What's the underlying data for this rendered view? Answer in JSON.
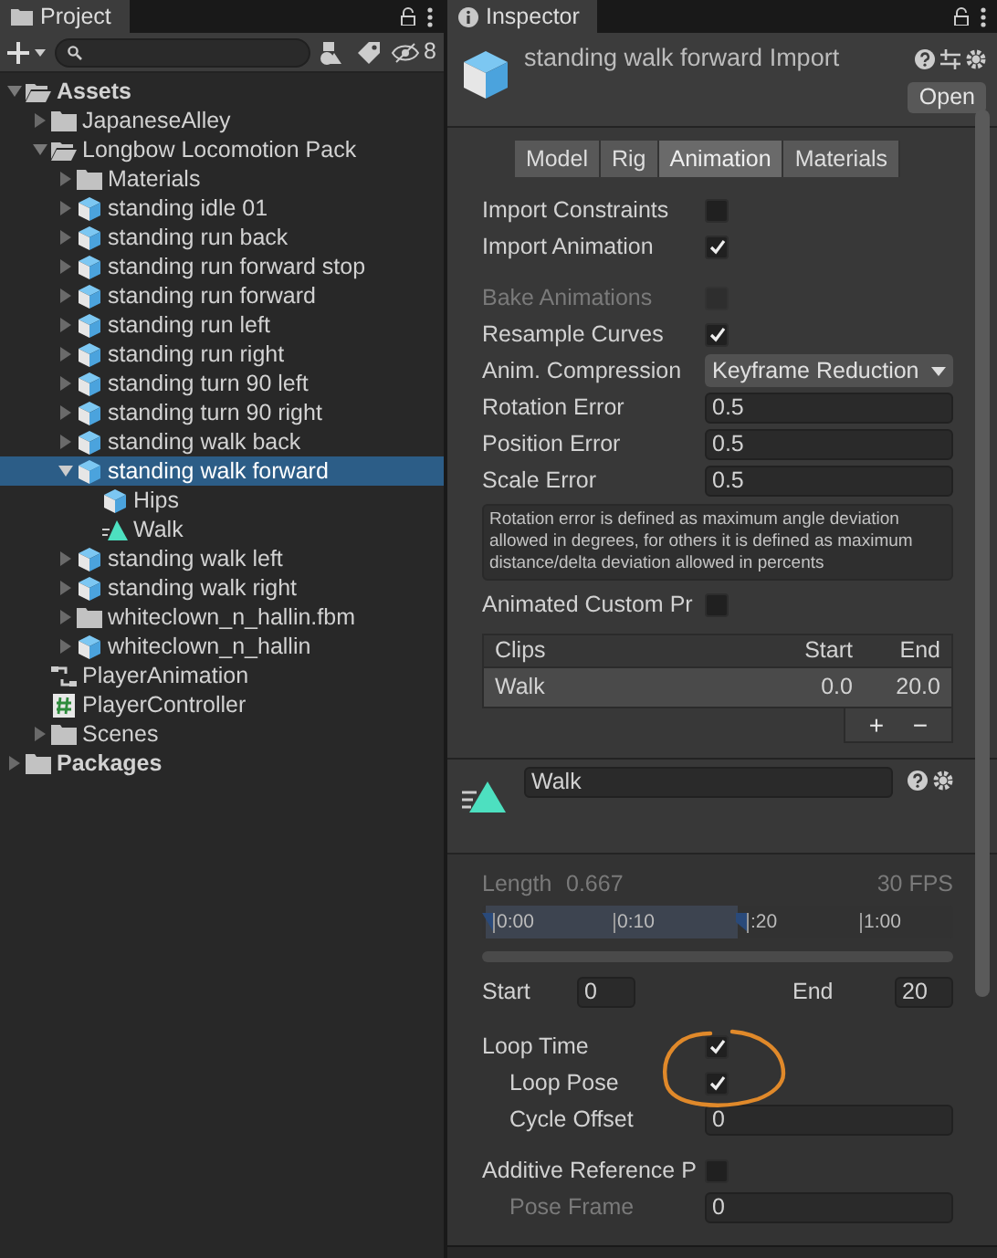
{
  "project": {
    "title": "Project",
    "hidden_count": "8",
    "tree": [
      {
        "label": "Assets",
        "kind": "folder",
        "expanded": true,
        "selected": false,
        "children": [
          {
            "label": "JapaneseAlley",
            "kind": "folder",
            "expanded": false,
            "selected": false
          },
          {
            "label": "Longbow Locomotion Pack",
            "kind": "folder",
            "expanded": true,
            "selected": false,
            "children": [
              {
                "label": "Materials",
                "kind": "folder",
                "expanded": false,
                "selected": false
              },
              {
                "label": "standing idle 01",
                "kind": "model",
                "expanded": false,
                "selected": false
              },
              {
                "label": "standing run back",
                "kind": "model",
                "expanded": false,
                "selected": false
              },
              {
                "label": "standing run forward stop",
                "kind": "model",
                "expanded": false,
                "selected": false
              },
              {
                "label": "standing run forward",
                "kind": "model",
                "expanded": false,
                "selected": false
              },
              {
                "label": "standing run left",
                "kind": "model",
                "expanded": false,
                "selected": false
              },
              {
                "label": "standing run right",
                "kind": "model",
                "expanded": false,
                "selected": false
              },
              {
                "label": "standing turn 90 left",
                "kind": "model",
                "expanded": false,
                "selected": false
              },
              {
                "label": "standing turn 90 right",
                "kind": "model",
                "expanded": false,
                "selected": false
              },
              {
                "label": "standing walk back",
                "kind": "model",
                "expanded": false,
                "selected": false
              },
              {
                "label": "standing walk forward",
                "kind": "model",
                "expanded": true,
                "selected": true,
                "children": [
                  {
                    "label": "Hips",
                    "kind": "model",
                    "selected": false
                  },
                  {
                    "label": "Walk",
                    "kind": "clip",
                    "selected": false
                  }
                ]
              },
              {
                "label": "standing walk left",
                "kind": "model",
                "expanded": false,
                "selected": false
              },
              {
                "label": "standing walk right",
                "kind": "model",
                "expanded": false,
                "selected": false
              },
              {
                "label": "whiteclown_n_hallin.fbm",
                "kind": "folder",
                "expanded": false,
                "selected": false
              },
              {
                "label": "whiteclown_n_hallin",
                "kind": "model",
                "expanded": false,
                "selected": false
              }
            ]
          },
          {
            "label": "PlayerAnimation",
            "kind": "controller",
            "selected": false
          },
          {
            "label": "PlayerController",
            "kind": "script",
            "selected": false
          },
          {
            "label": "Scenes",
            "kind": "folder",
            "expanded": false,
            "selected": false
          }
        ]
      },
      {
        "label": "Packages",
        "kind": "folder",
        "expanded": false,
        "selected": false
      }
    ]
  },
  "inspector": {
    "title": "Inspector",
    "asset_title": "standing walk forward Import",
    "open_button": "Open",
    "tabs": [
      {
        "label": "Model",
        "selected": false
      },
      {
        "label": "Rig",
        "selected": false
      },
      {
        "label": "Animation",
        "selected": true
      },
      {
        "label": "Materials",
        "selected": false
      }
    ],
    "fields": [
      {
        "kind": "checkbox",
        "label": "Import Constraints",
        "checked": false,
        "disabled": false
      },
      {
        "kind": "checkbox",
        "label": "Import Animation",
        "checked": true,
        "disabled": false
      },
      {
        "kind": "gap"
      },
      {
        "kind": "checkbox",
        "label": "Bake Animations",
        "checked": false,
        "disabled": true
      },
      {
        "kind": "checkbox",
        "label": "Resample Curves",
        "checked": true,
        "disabled": false
      },
      {
        "kind": "dropdown",
        "label": "Anim. Compression",
        "value": "Keyframe Reduction"
      },
      {
        "kind": "text",
        "label": "Rotation Error",
        "value": "0.5"
      },
      {
        "kind": "text",
        "label": "Position Error",
        "value": "0.5"
      },
      {
        "kind": "text",
        "label": "Scale Error",
        "value": "0.5"
      },
      {
        "kind": "help",
        "text": "Rotation error is defined as maximum angle deviation allowed in degrees, for others it is defined as maximum distance/delta deviation allowed in percents"
      },
      {
        "kind": "checkbox",
        "label": "Animated Custom Pr",
        "checked": false,
        "disabled": false
      }
    ],
    "clips": {
      "columns": [
        "Clips",
        "Start",
        "End"
      ],
      "rows": [
        {
          "name": "Walk",
          "start": "0.0",
          "end": "20.0",
          "selected": true
        }
      ],
      "buttons": [
        "+",
        "−"
      ]
    },
    "clip": {
      "name": "Walk",
      "length_label": "Length",
      "length": "0.667",
      "fps": "30 FPS",
      "ticks": [
        "0:00",
        "0:10",
        ":20",
        "1:00"
      ],
      "start_label": "Start",
      "start": "0",
      "end_label": "End",
      "end": "20",
      "settings": [
        {
          "kind": "checkbox",
          "label": "Loop Time",
          "checked": true,
          "indent": false,
          "disabled": false
        },
        {
          "kind": "checkbox",
          "label": "Loop Pose",
          "checked": true,
          "indent": true,
          "disabled": false
        },
        {
          "kind": "text",
          "label": "Cycle Offset",
          "value": "0",
          "indent": true,
          "disabled": false
        },
        {
          "kind": "gap"
        },
        {
          "kind": "checkbox",
          "label": "Additive Reference P",
          "checked": false,
          "indent": false,
          "disabled": false
        },
        {
          "kind": "text",
          "label": "Pose Frame",
          "value": "0",
          "indent": true,
          "disabled": true
        }
      ]
    }
  }
}
